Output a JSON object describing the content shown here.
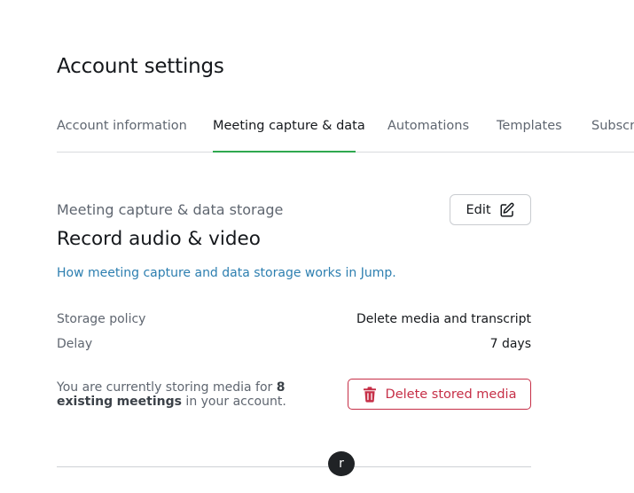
{
  "page": {
    "title": "Account settings"
  },
  "tabs": [
    {
      "label": "Account information",
      "active": false
    },
    {
      "label": "Meeting capture & data",
      "active": true
    },
    {
      "label": "Automations",
      "active": false
    },
    {
      "label": "Templates",
      "active": false
    },
    {
      "label": "Subscr",
      "active": false
    }
  ],
  "section": {
    "label": "Meeting capture & data storage",
    "title": "Record audio & video",
    "edit_label": "Edit",
    "help_link": "How meeting capture and data storage works in Jump."
  },
  "settings": [
    {
      "label": "Storage policy",
      "value": "Delete media and transcript"
    },
    {
      "label": "Delay",
      "value": "7 days"
    }
  ],
  "storage": {
    "note_prefix": "You are currently storing media for ",
    "note_bold_1": "8 existing",
    "note_bold_2": "meetings",
    "note_suffix": " in your account.",
    "delete_label": "Delete stored media"
  },
  "avatar": {
    "initial": "r"
  },
  "colors": {
    "tab_active_underline": "#2fa84f",
    "link": "#2d7fb0",
    "danger": "#c62f47"
  },
  "icons": {
    "edit": "pencil-square-icon",
    "delete": "trash-icon"
  }
}
